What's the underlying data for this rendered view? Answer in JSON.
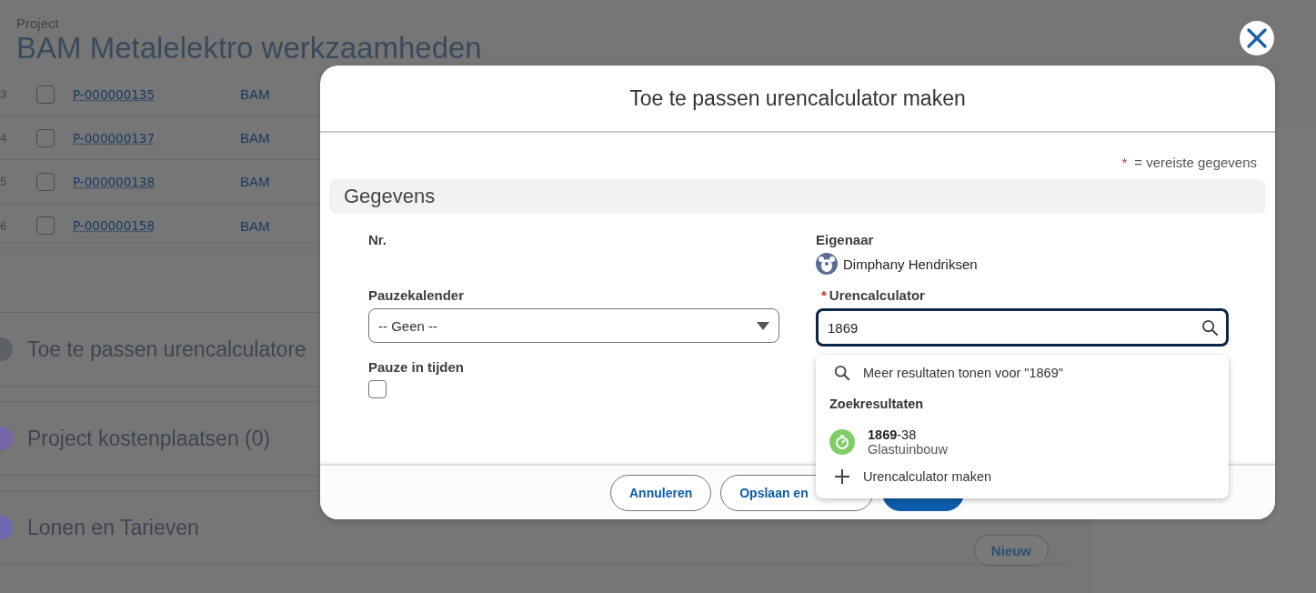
{
  "page": {
    "object_type": "Project",
    "title": "BAM Metalelektro werkzaamheden",
    "table_rows": [
      {
        "row_number": "3",
        "checked": false,
        "project_number": "P-000000135",
        "column_3": "BAM"
      },
      {
        "row_number": "4",
        "checked": false,
        "project_number": "P-000000137",
        "column_3": "BAM"
      },
      {
        "row_number": "5",
        "checked": false,
        "project_number": "P-000000138",
        "column_3": "BAM"
      },
      {
        "row_number": "6",
        "checked": false,
        "project_number": "P-000000158",
        "column_3": "BAM"
      }
    ],
    "related_lists": [
      {
        "title": "Toe te passen urencalculatore",
        "color": "#5e6068"
      },
      {
        "title": "Project kostenplaatsen (0)",
        "color": "#7565a8"
      },
      {
        "title": "Lonen en Tarieven",
        "color": "#6a68b0",
        "button": "Nieuw"
      }
    ]
  },
  "modal": {
    "title": "Toe te passen urencalculator maken",
    "required_note": {
      "mark": "*",
      "text": "= vereiste gegevens"
    },
    "section": "Gegevens",
    "fields": [
      {
        "kind": "readonly",
        "label": "Nr."
      },
      {
        "kind": "user",
        "label": "Eigenaar",
        "value": "Dimphany Hendriksen"
      },
      {
        "kind": "select",
        "label": "Pauzekalender",
        "value": "-- Geen --"
      },
      {
        "kind": "lookup",
        "label": "Urencalculator",
        "required_mark": "*",
        "value": "1869",
        "focused": true
      },
      {
        "kind": "checkbox",
        "label": "Pauze in tijden",
        "checked": false
      }
    ],
    "dropdown": {
      "more_results": "Meer resultaten tonen voor \"1869\"",
      "heading": "Zoekresultaten",
      "results": [
        {
          "title": "**1869**-38",
          "subtitle": "Glastuinbouw"
        }
      ],
      "create": "Urencalculator maken"
    },
    "buttons": [
      {
        "kind": "neutral",
        "label": "Annuleren"
      },
      {
        "kind": "neutral",
        "label": "Opslaan en"
      },
      {
        "kind": "brand"
      }
    ]
  }
}
